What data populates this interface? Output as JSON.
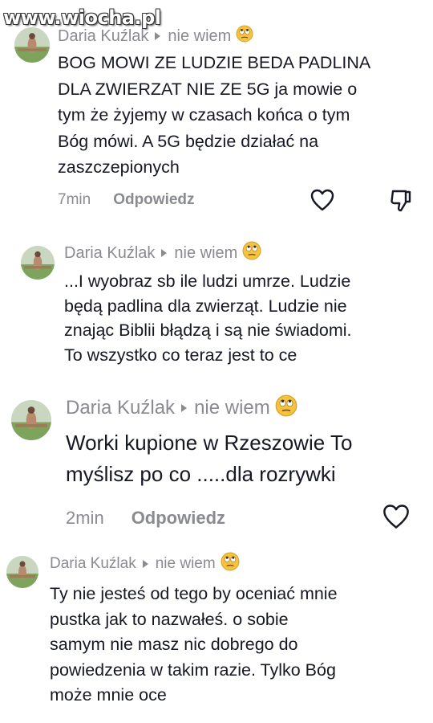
{
  "watermark": "www.wiocha.pl",
  "comments": [
    {
      "author": "Daria Kuźlak",
      "reply_to": "nie wiem",
      "emoji": "rolling-eyes",
      "lines": [
        "BOG MOWI ZE LUDZIE BEDA PADLINA",
        "DLA ZWIERZAT NIE ZE 5G ja mowie o",
        "tym że żyjemy w czasach końca o tym",
        "Bóg mówi. A 5G będzie działać na",
        "zaszczepionych"
      ],
      "time": "7min",
      "reply_label": "Odpowiedz"
    },
    {
      "author": "Daria Kuźlak",
      "reply_to": "nie wiem",
      "emoji": "rolling-eyes",
      "lines": [
        "...I wyobraz sb ile ludzi umrze. Ludzie",
        "będą padlina dla zwierząt. Ludzie nie",
        "znając Biblii błądzą i są nie świadomi.",
        "To wszystko co teraz jest to ce"
      ]
    },
    {
      "author": "Daria Kuźlak",
      "reply_to": "nie wiem",
      "emoji": "rolling-eyes",
      "lines": [
        "Worki kupione w Rzeszowie To",
        "myślisz po co .....dla rozrywki"
      ],
      "time": "2min",
      "reply_label": "Odpowiedz"
    },
    {
      "author": "Daria Kuźlak",
      "reply_to": "nie wiem",
      "emoji": "rolling-eyes",
      "lines": [
        "Ty nie jesteś od tego by oceniać mnie",
        "pustka jak to nazwałeś. o sobie",
        "samym nie masz nic dobrego do",
        "powiedzenia w takim razie. Tylko Bóg",
        "może mnie oce"
      ]
    }
  ],
  "icons": {
    "like": "heart-outline-icon",
    "dislike": "thumbs-down-icon",
    "emoji": "rolling-eyes-emoji"
  },
  "colors": {
    "text": "#161823",
    "muted": "#8a8b91",
    "background": "#ffffff"
  }
}
